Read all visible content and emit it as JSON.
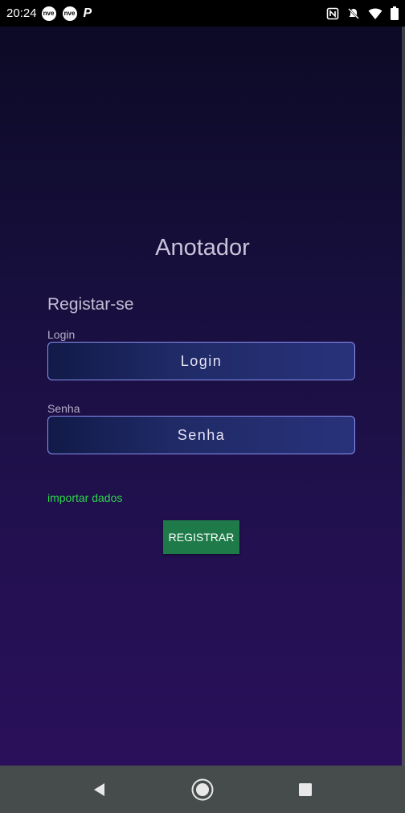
{
  "status_bar": {
    "time": "20:24",
    "notifications": [
      "nve-icon",
      "nve-icon",
      "p-icon"
    ],
    "p_letter": "P",
    "nve_text": "nve",
    "right_icons": [
      "nfc-icon",
      "mute-icon",
      "wifi-icon",
      "battery-icon"
    ]
  },
  "app": {
    "title": "Anotador",
    "subtitle": "Registar-se",
    "login_label": "Login",
    "login_placeholder": "Login",
    "password_label": "Senha",
    "password_placeholder": "Senha",
    "import_link": "importar dados",
    "register_button": "REGISTRAR"
  },
  "colors": {
    "accent_green_link": "#2bd64a",
    "button_green": "#1e7a48",
    "field_border": "#8b8ff0"
  },
  "nav_bar": {
    "buttons": [
      "back-icon",
      "home-icon",
      "recents-icon"
    ]
  }
}
